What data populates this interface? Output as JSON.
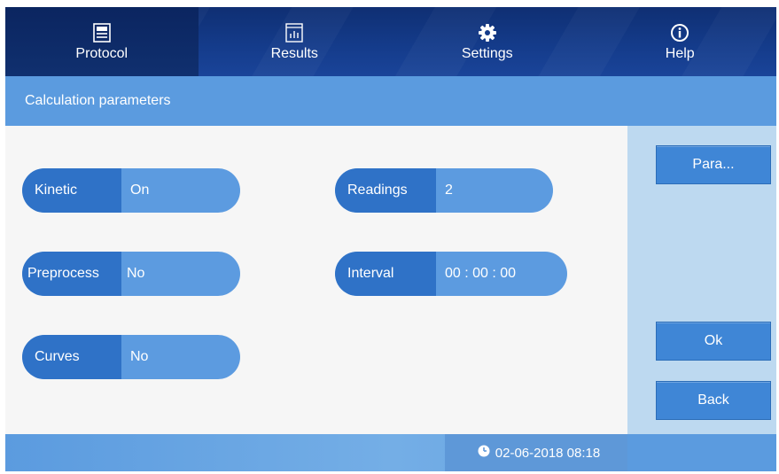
{
  "nav": {
    "tabs": [
      {
        "label": "Protocol",
        "icon": "protocol-icon",
        "active": true
      },
      {
        "label": "Results",
        "icon": "results-chart-icon",
        "active": false
      },
      {
        "label": "Settings",
        "icon": "gear-icon",
        "active": false
      },
      {
        "label": "Help",
        "icon": "info-icon",
        "active": false
      }
    ]
  },
  "section": {
    "title": "Calculation parameters"
  },
  "fields": {
    "kinetic": {
      "label": "Kinetic",
      "value": "On"
    },
    "preprocess": {
      "label": "Preprocess",
      "value": "No"
    },
    "curves": {
      "label": "Curves",
      "value": "No"
    },
    "readings": {
      "label": "Readings",
      "value": "2"
    },
    "interval": {
      "label": "Interval",
      "value": "00 : 00 : 00"
    }
  },
  "buttons": {
    "para": "Para...",
    "ok": "Ok",
    "back": "Back"
  },
  "footer": {
    "datetime": "02-06-2018 08:18",
    "clock_icon": "clock-icon"
  },
  "colors": {
    "nav_bg": "#143b8a",
    "header_bg": "#5b9bdf",
    "field_label_bg": "#2f72c7",
    "field_value_bg": "#5c9be0",
    "button_bg": "#3f86d6",
    "side_panel_bg": "#bdd9f0"
  }
}
